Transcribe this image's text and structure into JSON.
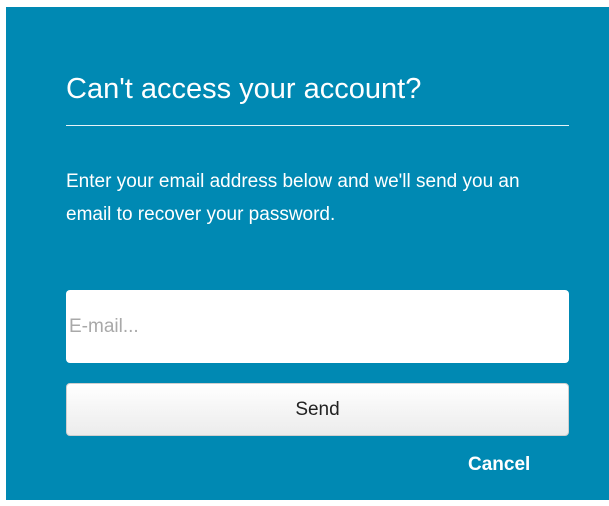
{
  "dialog": {
    "title": "Can't access your account?",
    "description": "Enter your email address below and we'll send you an email to recover your password.",
    "email_placeholder": "E-mail...",
    "email_value": "",
    "send_label": "Send",
    "cancel_label": "Cancel"
  },
  "colors": {
    "panel_background": "#0089B3",
    "text": "#FFFFFF",
    "button_background": "#F2F2F2"
  }
}
